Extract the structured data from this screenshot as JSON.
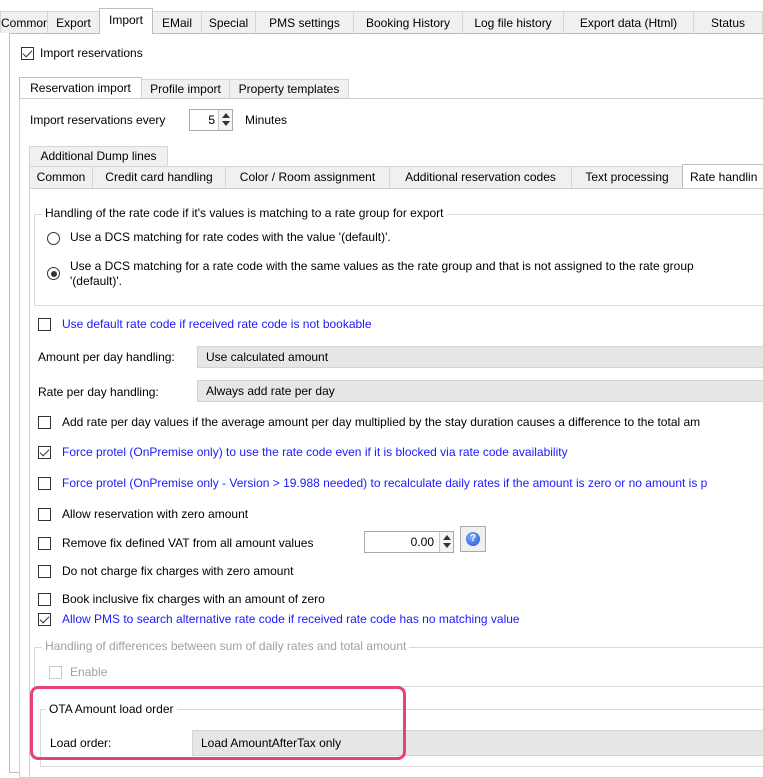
{
  "top_tabs": [
    "Common",
    "Export",
    "Import",
    "EMail",
    "Special",
    "PMS settings",
    "Booking History",
    "Log file history",
    "Export data (Html)",
    "Status"
  ],
  "import_reservations": {
    "label": "Import reservations",
    "checked": true
  },
  "import_tabs": [
    "Reservation import",
    "Profile import",
    "Property templates"
  ],
  "import_every": {
    "label": "Import reservations every",
    "value": "5",
    "unit": "Minutes"
  },
  "additional_tab": "Additional Dump lines",
  "inner_tabs": [
    "Common",
    "Credit card handling",
    "Color / Room assignment",
    "Additional reservation codes",
    "Text processing",
    "Rate handlin"
  ],
  "rate_group": {
    "title": "Handling of the rate code if it's values is matching to a rate group for export",
    "option1": "Use a DCS matching for rate codes with the value '(default)'.",
    "option2_line1": "Use a DCS matching for a rate code with the same values as the rate group and that is not assigned to the rate group",
    "option2_line2": "'(default)'."
  },
  "use_default_rate": "Use default rate code if received rate code is not bookable",
  "amount_per_day": {
    "label": "Amount per day handling:",
    "value": "Use calculated amount"
  },
  "rate_per_day": {
    "label": "Rate per day handling:",
    "value": "Always add rate per day"
  },
  "checkboxes": {
    "add_rate": "Add rate per day values if the average amount per day multiplied by the stay duration causes a difference to the total am",
    "force_protel": "Force protel (OnPremise only) to use the rate code even if it is blocked via rate code availability",
    "force_protel_recalc": "Force protel (OnPremise only - Version > 19.988 needed) to recalculate daily rates if the amount is zero or no amount is p",
    "allow_zero": "Allow reservation with zero amount",
    "remove_vat": "Remove fix defined VAT from all amount values",
    "vat_value": "0.00",
    "no_charge": "Do not charge fix charges with zero amount",
    "book_inclusive": "Book inclusive fix charges with an amount of zero",
    "allow_pms": "Allow PMS to search alternative rate code if received rate code has no matching value"
  },
  "differences_group": {
    "title": "Handling of differences between sum of daily rates and total amount",
    "enable": "Enable"
  },
  "ota_group": {
    "title": "OTA Amount load order",
    "label": "Load order:",
    "value": "Load AmountAfterTax only"
  },
  "colors": {
    "highlight": "#e8417a",
    "link_blue": "#1a1aff"
  },
  "icons": [
    "help-icon"
  ]
}
